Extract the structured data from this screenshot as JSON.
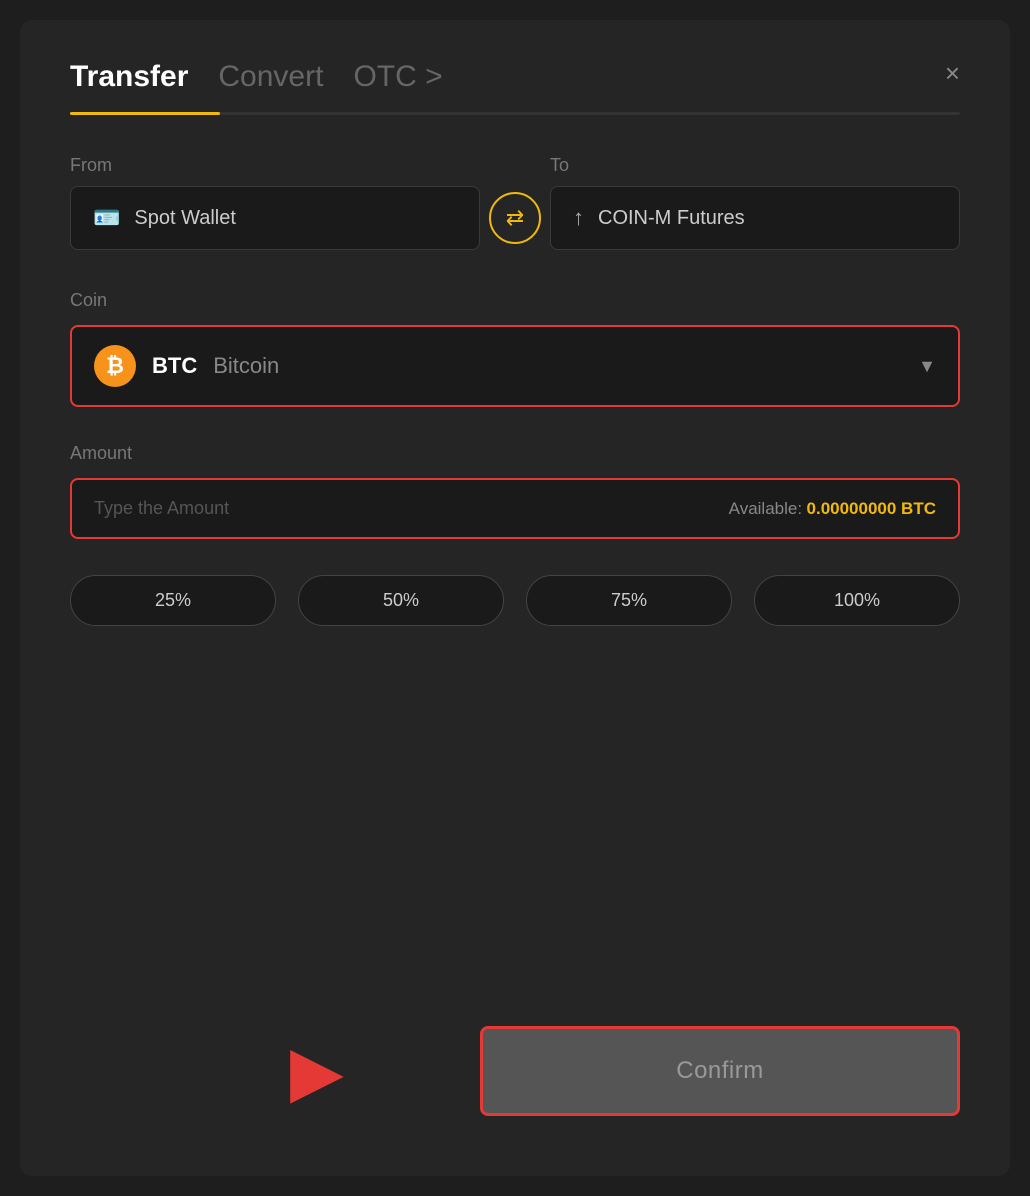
{
  "header": {
    "tab_transfer": "Transfer",
    "tab_convert": "Convert",
    "tab_otc": "OTC >",
    "close_label": "×"
  },
  "from_section": {
    "label": "From",
    "wallet_name": "Spot Wallet"
  },
  "to_section": {
    "label": "To",
    "wallet_name": "COIN-M Futures"
  },
  "swap_icon": "⇄",
  "coin_section": {
    "label": "Coin",
    "coin_symbol": "BTC",
    "coin_full_name": "Bitcoin",
    "btc_icon_letter": "₿",
    "chevron": "▼"
  },
  "amount_section": {
    "label": "Amount",
    "placeholder": "Type the Amount",
    "available_label": "Available:",
    "available_value": "0.00000000 BTC"
  },
  "percent_buttons": [
    "25%",
    "50%",
    "75%",
    "100%"
  ],
  "confirm_button": {
    "label": "Confirm"
  },
  "arrow_indicator": "➤"
}
